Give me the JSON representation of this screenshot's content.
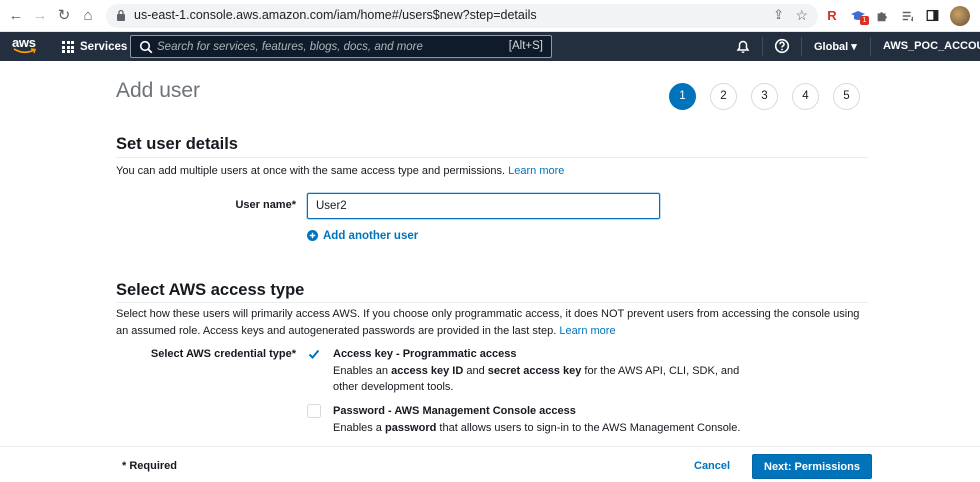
{
  "browser": {
    "url": "us-east-1.console.aws.amazon.com/iam/home#/users$new?step=details",
    "extension_r_label": "R",
    "extension_badge": "1"
  },
  "aws_nav": {
    "logo_text": "aws",
    "services_label": "Services",
    "search_placeholder": "Search for services, features, blogs, docs, and more",
    "search_shortcut": "[Alt+S]",
    "region_label": "Global ▾",
    "account_label": "AWS_POC_ACCOUNT"
  },
  "page": {
    "title": "Add user",
    "steps": [
      "1",
      "2",
      "3",
      "4",
      "5"
    ],
    "active_step": 1
  },
  "user_details": {
    "section_title": "Set user details",
    "description": "You can add multiple users at once with the same access type and permissions.",
    "learn_more": "Learn more",
    "username_label": "User name*",
    "username_value": "User2",
    "add_another_user": "Add another user"
  },
  "access_type": {
    "section_title": "Select AWS access type",
    "description_line1": "Select how these users will primarily access AWS. If you choose only programmatic access, it does NOT prevent users from accessing the console using",
    "description_line2": "an assumed role. Access keys and autogenerated passwords are provided in the last step.",
    "learn_more": "Learn more",
    "credential_label": "Select AWS credential type*",
    "options": [
      {
        "title": "Access key - Programmatic access",
        "checked": true,
        "desc_prefix": "Enables an ",
        "desc_bold1": "access key ID",
        "desc_mid": " and ",
        "desc_bold2": "secret access key",
        "desc_suffix": " for the AWS API, CLI, SDK, and other development tools."
      },
      {
        "title": "Password - AWS Management Console access",
        "checked": false,
        "desc_prefix": "Enables a ",
        "desc_bold1": "password",
        "desc_suffix": " that allows users to sign-in to the AWS Management Console."
      }
    ]
  },
  "footer": {
    "required_label": "* Required",
    "cancel_label": "Cancel",
    "next_label": "Next: Permissions"
  },
  "colors": {
    "aws_nav_bg": "#232f3e",
    "primary_blue": "#0073bb",
    "link_blue": "#0073bb"
  }
}
